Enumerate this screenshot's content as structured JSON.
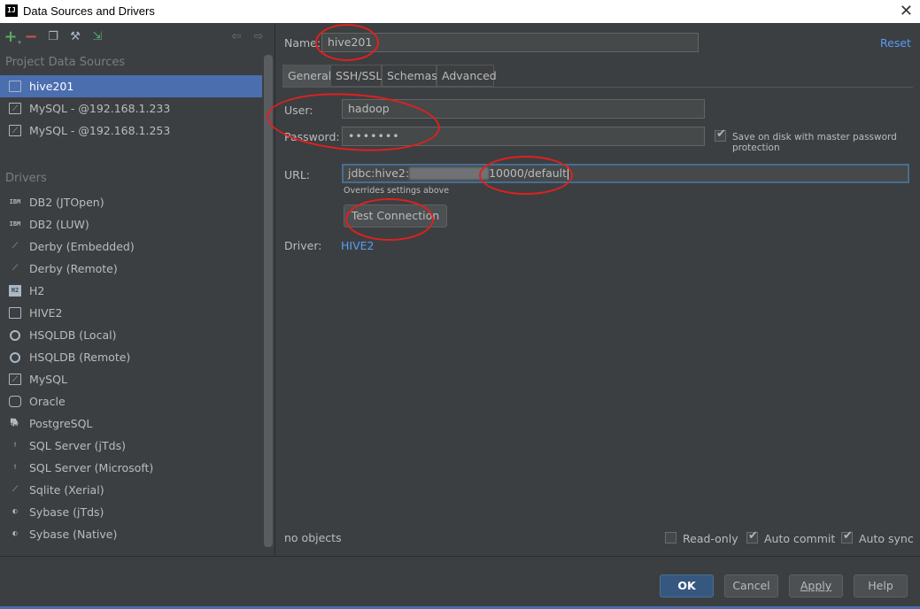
{
  "window": {
    "title": "Data Sources and Drivers",
    "app_icon": "IJ"
  },
  "toolbar": {
    "icons": [
      "add-icon",
      "remove-icon",
      "copy-icon",
      "settings-icon",
      "import-icon",
      "back-icon",
      "forward-icon"
    ]
  },
  "sidebar": {
    "project_title": "Project Data Sources",
    "project_items": [
      {
        "label": "hive201",
        "icon": "hive-icon"
      },
      {
        "label": "MySQL - @192.168.1.233",
        "icon": "mysql-icon"
      },
      {
        "label": "MySQL - @192.168.1.253",
        "icon": "mysql-icon"
      }
    ],
    "drivers_title": "Drivers",
    "drivers": [
      {
        "label": "DB2 (JTOpen)",
        "icon_text": "IBM"
      },
      {
        "label": "DB2 (LUW)",
        "icon_text": "IBM"
      },
      {
        "label": "Derby (Embedded)",
        "icon_text": "⟋"
      },
      {
        "label": "Derby (Remote)",
        "icon_text": "⟋"
      },
      {
        "label": "H2",
        "icon_text": "H2"
      },
      {
        "label": "HIVE2",
        "icon_text": ""
      },
      {
        "label": "HSQLDB (Local)",
        "icon_text": ""
      },
      {
        "label": "HSQLDB (Remote)",
        "icon_text": ""
      },
      {
        "label": "MySQL",
        "icon_text": "⟋"
      },
      {
        "label": "Oracle",
        "icon_text": ""
      },
      {
        "label": "PostgreSQL",
        "icon_text": "🐘"
      },
      {
        "label": "SQL Server (jTds)",
        "icon_text": "⟊"
      },
      {
        "label": "SQL Server (Microsoft)",
        "icon_text": "⟊"
      },
      {
        "label": "Sqlite (Xerial)",
        "icon_text": "⟋"
      },
      {
        "label": "Sybase (jTds)",
        "icon_text": "◐"
      },
      {
        "label": "Sybase (Native)",
        "icon_text": "◐"
      }
    ]
  },
  "form": {
    "name_label": "Name:",
    "name_value": "hive201",
    "reset_label": "Reset",
    "tabs": [
      "General",
      "SSH/SSL",
      "Schemas",
      "Advanced"
    ],
    "user_label": "User:",
    "user_value": "hadoop",
    "password_label": "Password:",
    "password_value": "•••••••",
    "save_password_label": "Save on disk with master password protection",
    "url_label": "URL:",
    "url_prefix": "jdbc:hive2:",
    "url_suffix": "10000/default",
    "url_hint": "Overrides settings above",
    "test_connection_label": "Test Connection",
    "driver_label": "Driver:",
    "driver_value": "HIVE2"
  },
  "status": {
    "objects_text": "no objects",
    "readonly_label": "Read-only",
    "readonly_checked": false,
    "autocommit_label": "Auto commit",
    "autocommit_checked": true,
    "autosync_label": "Auto sync",
    "autosync_checked": true
  },
  "buttons": {
    "ok": "OK",
    "cancel": "Cancel",
    "apply": "Apply",
    "help": "Help"
  },
  "colors": {
    "background": "#3c3f41",
    "selection": "#4b6eaf",
    "link": "#589df6",
    "annotation": "#e02020"
  }
}
